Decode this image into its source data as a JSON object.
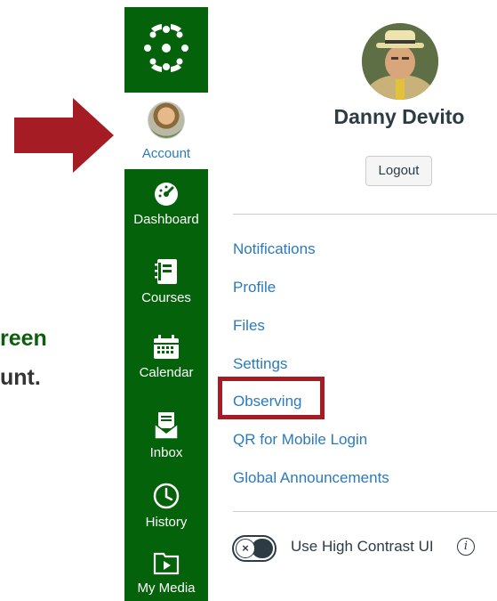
{
  "instructions": {
    "line1": "reen",
    "line2": "unt."
  },
  "nav": {
    "account_label": "Account",
    "items": [
      {
        "label": "Dashboard",
        "icon": "dashboard-icon"
      },
      {
        "label": "Courses",
        "icon": "courses-icon"
      },
      {
        "label": "Calendar",
        "icon": "calendar-icon"
      },
      {
        "label": "Inbox",
        "icon": "inbox-icon"
      },
      {
        "label": "History",
        "icon": "history-icon"
      },
      {
        "label": "My Media",
        "icon": "my-media-icon"
      }
    ]
  },
  "tray": {
    "user_name": "Danny Devito",
    "logout_label": "Logout",
    "links": [
      "Notifications",
      "Profile",
      "Files",
      "Settings",
      "Observing",
      "QR for Mobile Login",
      "Global Announcements"
    ],
    "high_contrast_label": "Use High Contrast UI",
    "toggle_glyph": "×",
    "info_glyph": "i"
  },
  "colors": {
    "nav_green": "#04620a",
    "link_blue": "#2b7abc",
    "highlight_red": "#a51c24"
  }
}
